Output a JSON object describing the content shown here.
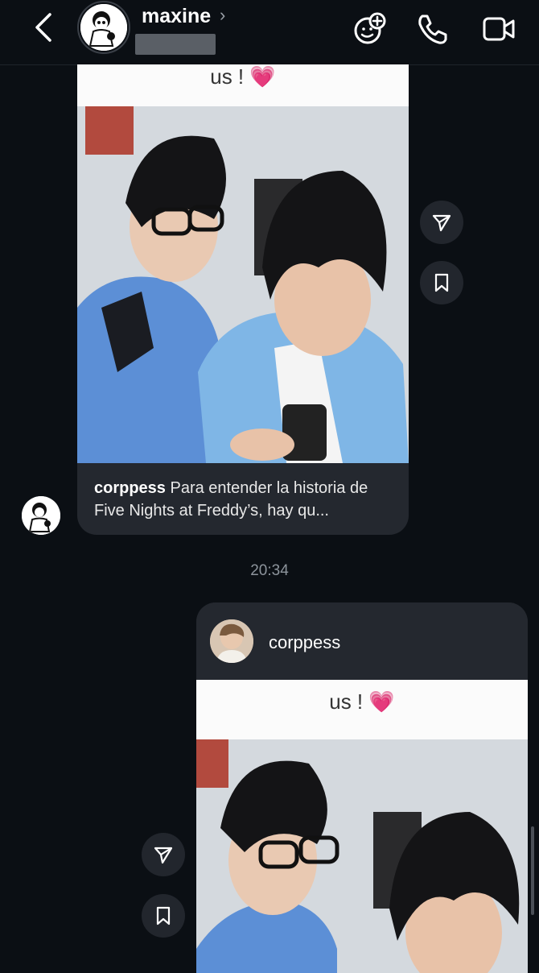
{
  "header": {
    "back_icon": "chevron-left-icon",
    "contact_name": "maxine",
    "contact_chevron": "›",
    "subtitle_redacted": true,
    "actions": [
      "effects-face-add-icon",
      "phone-icon",
      "video-camera-icon"
    ]
  },
  "shared_post_1": {
    "image_caption": "us ! 💗",
    "author": "corppess",
    "caption_text": " Para entender la historia de Five Nights at Freddy’s, hay qu..."
  },
  "time_divider": "20:34",
  "shared_post_2": {
    "author": "corppess",
    "image_caption": "us ! 💗"
  },
  "colors": {
    "background": "#0b0f14",
    "bubble": "#24282f",
    "muted_text": "#8d949c"
  }
}
